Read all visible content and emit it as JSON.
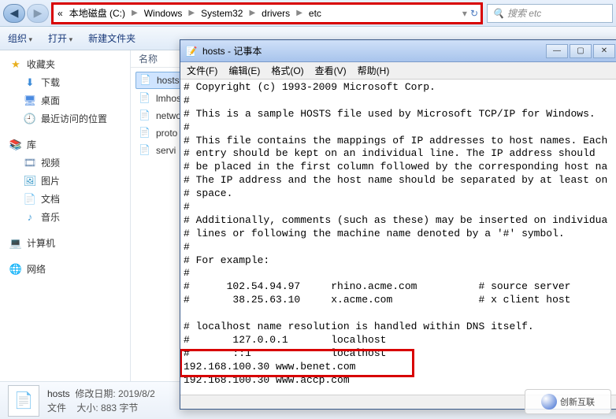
{
  "explorer": {
    "breadcrumbs": [
      "本地磁盘 (C:)",
      "Windows",
      "System32",
      "drivers",
      "etc"
    ],
    "search_placeholder": "搜索 etc",
    "toolbar": {
      "organize": "组织",
      "open": "打开",
      "new_folder": "新建文件夹"
    },
    "sidebar": {
      "favorites": {
        "label": "收藏夹",
        "items": [
          "下载",
          "桌面",
          "最近访问的位置"
        ]
      },
      "libraries": {
        "label": "库",
        "items": [
          "视频",
          "图片",
          "文档",
          "音乐"
        ]
      },
      "computer": {
        "label": "计算机"
      },
      "network": {
        "label": "网络"
      }
    },
    "column_header": "名称",
    "files": [
      "hosts",
      "lmhosts",
      "netwo",
      "proto",
      "servi"
    ],
    "details": {
      "name": "hosts",
      "date_label": "修改日期:",
      "date_value": "2019/8/2",
      "type_label": "文件",
      "size_label": "大小:",
      "size_value": "883 字节"
    }
  },
  "notepad": {
    "title": "hosts - 记事本",
    "menu": [
      "文件(F)",
      "编辑(E)",
      "格式(O)",
      "查看(V)",
      "帮助(H)"
    ],
    "content": "# Copyright (c) 1993-2009 Microsoft Corp.\n#\n# This is a sample HOSTS file used by Microsoft TCP/IP for Windows.\n#\n# This file contains the mappings of IP addresses to host names. Each\n# entry should be kept on an individual line. The IP address should\n# be placed in the first column followed by the corresponding host na\n# The IP address and the host name should be separated by at least on\n# space.\n#\n# Additionally, comments (such as these) may be inserted on individua\n# lines or following the machine name denoted by a '#' symbol.\n#\n# For example:\n#\n#      102.54.94.97     rhino.acme.com          # source server\n#       38.25.63.10     x.acme.com              # x client host\n\n# localhost name resolution is handled within DNS itself.\n#       127.0.0.1       localhost\n#       ::1             localhost\n192.168.100.30 www.benet.com\n192.168.100.30 www.accp.com"
  },
  "watermark": "创新互联"
}
